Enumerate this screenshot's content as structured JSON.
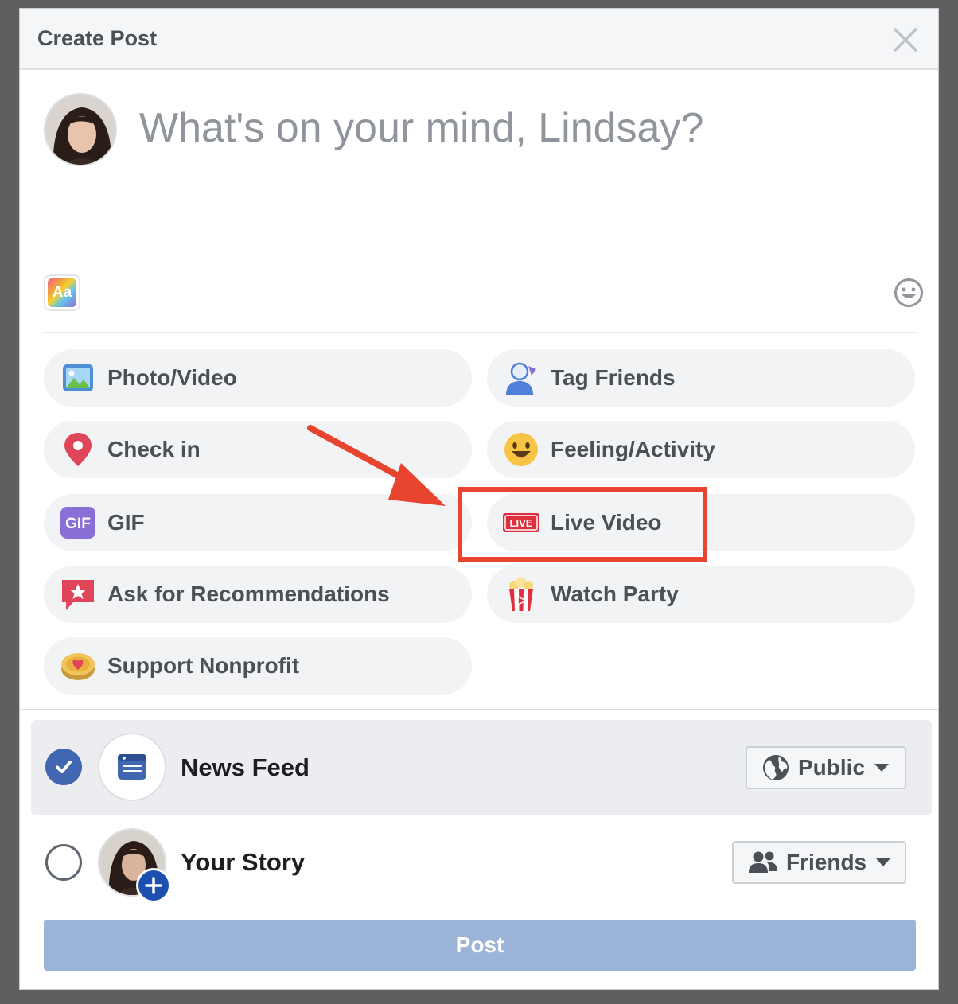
{
  "dialog": {
    "title": "Create Post",
    "close_icon": "close-icon"
  },
  "composer": {
    "placeholder": "What's on your mind, Lindsay?",
    "text_style_button": "Aa",
    "emoji_icon": "smiley-icon"
  },
  "options": {
    "photo_video": "Photo/Video",
    "tag_friends": "Tag Friends",
    "check_in": "Check in",
    "feeling_activity": "Feeling/Activity",
    "gif": "GIF",
    "live_video": "Live Video",
    "live_badge": "LIVE",
    "ask_recommendations": "Ask for Recommendations",
    "watch_party": "Watch Party",
    "support_nonprofit": "Support Nonprofit"
  },
  "destinations": {
    "news_feed": {
      "label": "News Feed",
      "checked": true,
      "audience": "Public"
    },
    "your_story": {
      "label": "Your Story",
      "checked": false,
      "audience": "Friends"
    }
  },
  "post_button": "Post",
  "colors": {
    "accent": "#4267b2",
    "annotation": "#e8442f",
    "post_disabled": "#9cb4d8"
  }
}
